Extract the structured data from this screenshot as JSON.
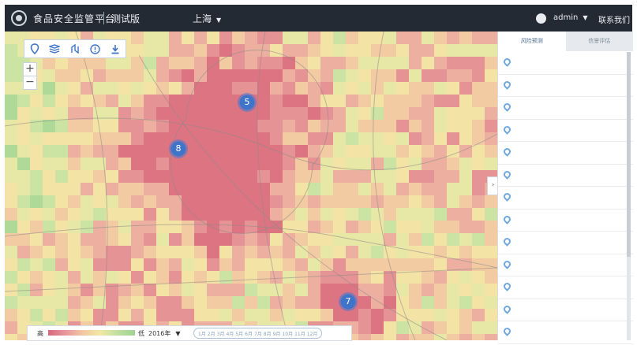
{
  "header": {
    "app_title": "食品安全监管平台",
    "env_label": "测试版",
    "city": "上海",
    "user": "admin",
    "contact": "联系我们"
  },
  "map": {
    "toolbar_icons": [
      "marker-icon",
      "layers-icon",
      "route-icon",
      "info-icon",
      "download-icon"
    ],
    "zoom_in": "+",
    "zoom_out": "−",
    "clusters": [
      "5",
      "8",
      "7"
    ]
  },
  "legend": {
    "high": "高",
    "low": "低",
    "year": "2016年",
    "months": [
      "1月",
      "2月",
      "3月",
      "4月",
      "5月",
      "6月",
      "7月",
      "8月",
      "9月",
      "10月",
      "11月",
      "12月"
    ]
  },
  "panel": {
    "tabs": [
      "风险预测",
      "信誉评估"
    ],
    "items": [
      "",
      "",
      "",
      "",
      "",
      "",
      "",
      "",
      "",
      "",
      "",
      "",
      ""
    ],
    "collapse": "›"
  },
  "colors": {
    "topbar": "#232a33",
    "cluster": "#3f74c8",
    "high_risk": "#d9677d",
    "low_risk": "#9fd392"
  }
}
